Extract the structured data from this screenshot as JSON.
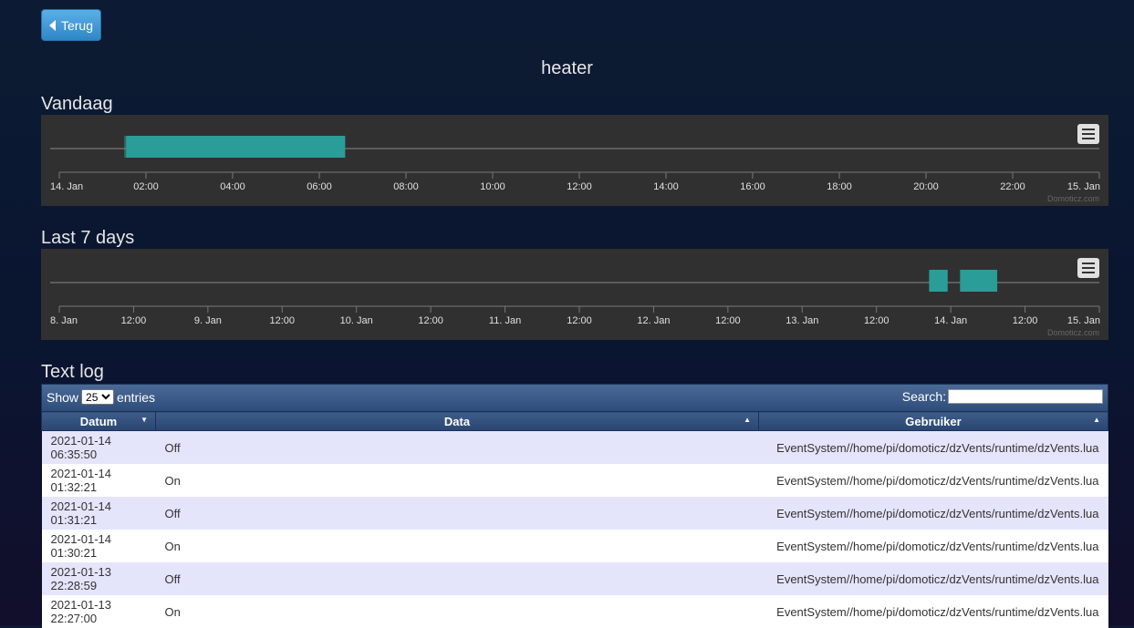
{
  "back_button": {
    "label": "Terug"
  },
  "page_title": "heater",
  "sections": {
    "today": "Vandaag",
    "week": "Last 7 days",
    "log": "Text log"
  },
  "charts": {
    "credit": "Domoticz.com",
    "series_color": "#2a9d98",
    "today_ticks": [
      "14. Jan",
      "02:00",
      "04:00",
      "06:00",
      "08:00",
      "10:00",
      "12:00",
      "14:00",
      "16:00",
      "18:00",
      "20:00",
      "22:00",
      "15. Jan"
    ],
    "week_ticks": [
      "8. Jan",
      "12:00",
      "9. Jan",
      "12:00",
      "10. Jan",
      "12:00",
      "11. Jan",
      "12:00",
      "12. Jan",
      "12:00",
      "13. Jan",
      "12:00",
      "14. Jan",
      "12:00",
      "15. Jan"
    ]
  },
  "chart_data": [
    {
      "type": "timeline",
      "title": "",
      "x_range": [
        "2021-01-14 00:00",
        "2021-01-15 00:00"
      ],
      "on_intervals": [
        {
          "start": "2021-01-14 01:30:21",
          "end": "2021-01-14 01:31:21"
        },
        {
          "start": "2021-01-14 01:32:21",
          "end": "2021-01-14 06:35:50"
        }
      ]
    },
    {
      "type": "timeline",
      "title": "",
      "x_range": [
        "2021-01-08 00:00",
        "2021-01-15 00:00"
      ],
      "on_intervals": [
        {
          "start": "2021-01-13 20:30",
          "end": "2021-01-13 23:30"
        },
        {
          "start": "2021-01-14 01:30",
          "end": "2021-01-14 07:30"
        }
      ]
    }
  ],
  "log_controls": {
    "show_label": "Show",
    "entries_label": "entries",
    "page_size": "25",
    "search_label": "Search:",
    "search_value": ""
  },
  "log_table": {
    "columns": [
      "Datum",
      "Data",
      "Gebruiker"
    ],
    "rows": [
      {
        "date": "2021-01-14",
        "time": "06:35:50",
        "data": "Off",
        "user": "EventSystem//home/pi/domoticz/dzVents/runtime/dzVents.lua"
      },
      {
        "date": "2021-01-14",
        "time": "01:32:21",
        "data": "On",
        "user": "EventSystem//home/pi/domoticz/dzVents/runtime/dzVents.lua"
      },
      {
        "date": "2021-01-14",
        "time": "01:31:21",
        "data": "Off",
        "user": "EventSystem//home/pi/domoticz/dzVents/runtime/dzVents.lua"
      },
      {
        "date": "2021-01-14",
        "time": "01:30:21",
        "data": "On",
        "user": "EventSystem//home/pi/domoticz/dzVents/runtime/dzVents.lua"
      },
      {
        "date": "2021-01-13",
        "time": "22:28:59",
        "data": "Off",
        "user": "EventSystem//home/pi/domoticz/dzVents/runtime/dzVents.lua"
      },
      {
        "date": "2021-01-13",
        "time": "22:27:00",
        "data": "On",
        "user": "EventSystem//home/pi/domoticz/dzVents/runtime/dzVents.lua"
      }
    ]
  }
}
